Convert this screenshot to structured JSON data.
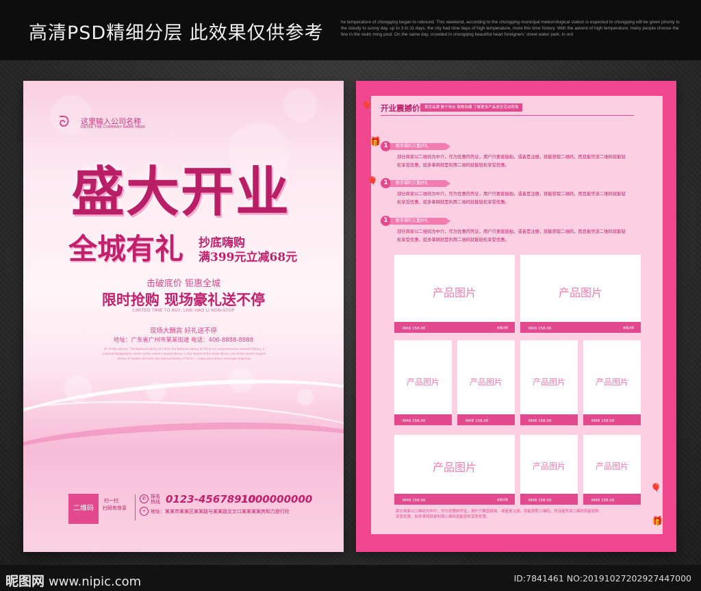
{
  "banner": {
    "title": "高清PSD精细分层 此效果仅供参考",
    "description": "he temperature of chongqing began to rebound. This weekend, according to the chongqing municipal meteorological station is expected to chongqing will be given priority to the cloudy to sunny day, up to 3 to 11 days, the city had nine days of high temperature, more this time history. With the advent of high temperature, many people choose the few in the swim ming pool. On the same day, crowded in chongqing beautiful heart foreigners' street water park, in ord"
  },
  "left_flyer": {
    "company_name": "这里输入公司名称",
    "company_en": "ENTER THE COMPANY NAME HERE",
    "headline": "盛大开业",
    "subhead": "全城有礼",
    "promo_line1": "抄底嗨购",
    "promo_line2": "满399元立减68元",
    "tagline": "击破底价 钜惠全城",
    "slogan": "限时抢购 现场豪礼送不停",
    "slogan_en": "LIMITED TIME TO BUY, LIVE HAO LI NON-STOP",
    "event_line": "现场大酬宾 好礼送不停",
    "address_line": "地址：广东省广州市某某街道   电话：400-8888-8888",
    "fine_print": "Or 'Pretty daisies', The National Library of China, the National Library of China is a comprehensive research library, a national bibliographic center of the nation's largest library, is the largest of the Asian library, one of the world's largest library of modern libraries, the national library of China — Leave your phone messages enquiries",
    "qr_label": "二维码",
    "scan_line1": "扫一扫",
    "scan_line2": "扫码有惊喜",
    "hotline_label": "报名热线",
    "phone1": "0123-45678910",
    "phone2": "1000000000",
    "address2": "地址：某某市某某区某某路与某某路交叉口某某某某房和力旅行社"
  },
  "right_flyer": {
    "section_title": "开业震撼价",
    "section_tags": "首页品牌  数千特价  致歌劲爆   了解更多产品请至活动现场",
    "items": [
      {
        "num": "1",
        "label": "新手福利三重好礼",
        "text": "部分商家以二维码为中介，作为优惠的凭证，用户只要直接拍，或者是注册，就能获取二维码，而且能凭该二维码就能轻松享受优惠，如多拿网就是利用二维码就能轻松享受优惠。"
      },
      {
        "num": "1",
        "label": "新手福利三重好礼",
        "text": "部分商家以二维码为中介，作为优惠的凭证，用户只要直接拍，或者是注册，就能获取二维码，而且能凭该二维码就能轻松享受优惠，如多拿网就是利用二维码就能轻松享受优惠。"
      },
      {
        "num": "1",
        "label": "新手福利三重好礼",
        "text": "部分商家以二维码为中介，作为优惠的凭证，用户只要直接拍，或者是注册，就能获取二维码，而且能凭该二维码就能轻松享受优惠，如多拿网就是利用二维码就能轻松享受优惠。"
      }
    ],
    "product_label": "产品图片",
    "price_label": "RMB 158.00",
    "more_label": "查看详情",
    "footnote": "部分商家以二维码为中介，作为优惠的凭证，用户只要直接拍，或者是注册，就能获取二维码，而且能凭该二维码就能轻松享受优惠，如多拿网就是利用二维码就能轻松享受优惠。"
  },
  "watermark": {
    "site_name": "昵图网",
    "site_url": "www.nipic.com",
    "id_text": "ID:7841461 NO:20191027202927447000"
  },
  "colors": {
    "brand_pink": "#e2498e",
    "deep_pink": "#b81f66",
    "flyer_border": "#f0468e",
    "panel_pink": "#fcd0e2"
  }
}
